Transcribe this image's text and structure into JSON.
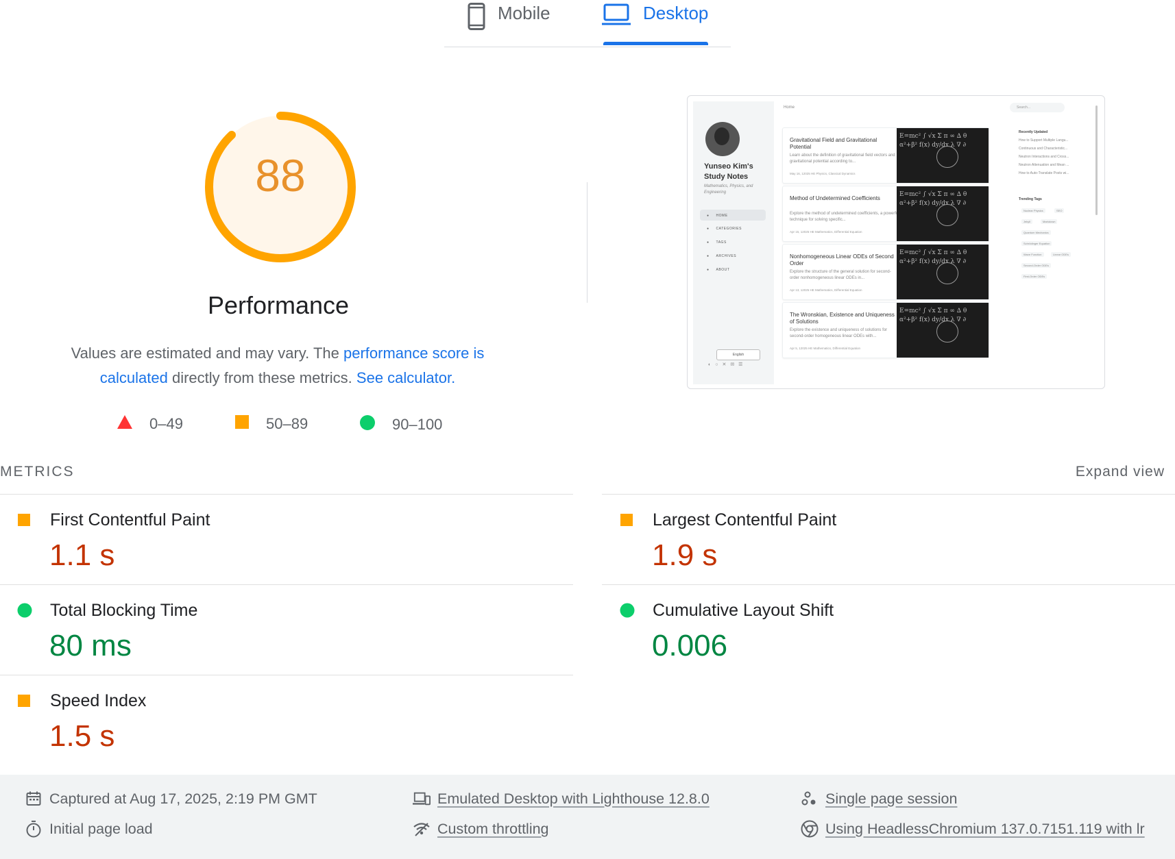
{
  "tabs": {
    "mobile": "Mobile",
    "desktop": "Desktop"
  },
  "score": {
    "value": "88",
    "level": 0.88,
    "title": "Performance"
  },
  "description": {
    "pre": "Values are estimated and may vary. The ",
    "link1": "performance score is calculated",
    "mid": " directly from these metrics. ",
    "link2": "See calculator."
  },
  "legend": {
    "fail": "0–49",
    "average": "50–89",
    "pass": "90–100"
  },
  "colors": {
    "orange": "#ffa400",
    "red": "#ff3333",
    "green": "#0cce6b",
    "blue": "#1a73e8",
    "value_orange": "#c33300",
    "value_green": "#018642"
  },
  "screenshot": {
    "site_title": "Yunseo Kim's Study Notes",
    "site_subtitle": "Mathematics, Physics, and Engineering",
    "breadcrumb": "Home",
    "search_placeholder": "Search...",
    "nav": [
      "HOME",
      "CATEGORIES",
      "TAGS",
      "ARCHIVES",
      "ABOUT"
    ],
    "language": "English",
    "posts": [
      {
        "title": "Gravitational Field and Gravitational Potential",
        "desc": "Learn about the definition of gravitational field vectors and gravitational potential according to...",
        "meta": "May 16, 12025 HE   Physics, Classical Dynamics"
      },
      {
        "title": "Method of Undetermined Coefficients",
        "desc": "Explore the method of undetermined coefficients, a powerful technique for solving specific...",
        "meta": "Apr 15, 12025 HE   Mathematics, Differential Equation"
      },
      {
        "title": "Nonhomogeneous Linear ODEs of Second Order",
        "desc": "Explore the structure of the general solution for second-order nonhomogeneous linear ODEs in...",
        "meta": "Apr 13, 12025 HE   Mathematics, Differential Equation"
      },
      {
        "title": "The Wronskian, Existence and Uniqueness of Solutions",
        "desc": "Explore the existence and uniqueness of solutions for second-order homogeneous linear ODEs with...",
        "meta": "Apr 5, 12025 HE   Mathematics, Differential Equation"
      }
    ],
    "recently_updated_title": "Recently Updated",
    "recently_updated": [
      "How to Support Multiple Langu...",
      "Continuous and Characteristic...",
      "Neutron Interactions and Cross...",
      "Neutron Attenuation and Mean ...",
      "How to Auto-Translate Posts wi..."
    ],
    "trending_tags_title": "Trending Tags",
    "tags": [
      "Nuclear Physics",
      "SEO",
      "Jekyll",
      "Markdown",
      "Quantum Mechanics",
      "Schrödinger Equation",
      "Wave Function",
      "Linear ODEs",
      "Second-Order ODEs",
      "First-Order ODEs"
    ]
  },
  "metrics": {
    "heading": "METRICS",
    "expand": "Expand view",
    "fcp": {
      "label": "First Contentful Paint",
      "value": "1.1 s",
      "rating": "average"
    },
    "lcp": {
      "label": "Largest Contentful Paint",
      "value": "1.9 s",
      "rating": "average"
    },
    "tbt": {
      "label": "Total Blocking Time",
      "value": "80 ms",
      "rating": "pass"
    },
    "cls": {
      "label": "Cumulative Layout Shift",
      "value": "0.006",
      "rating": "pass"
    },
    "si": {
      "label": "Speed Index",
      "value": "1.5 s",
      "rating": "average"
    }
  },
  "footer": {
    "captured": "Captured at Aug 17, 2025, 2:19 PM GMT",
    "emulated": "Emulated Desktop with Lighthouse 12.8.0",
    "session": "Single page session",
    "initial_load": "Initial page load",
    "throttling": "Custom throttling",
    "browser": "Using HeadlessChromium 137.0.7151.119 with lr"
  }
}
